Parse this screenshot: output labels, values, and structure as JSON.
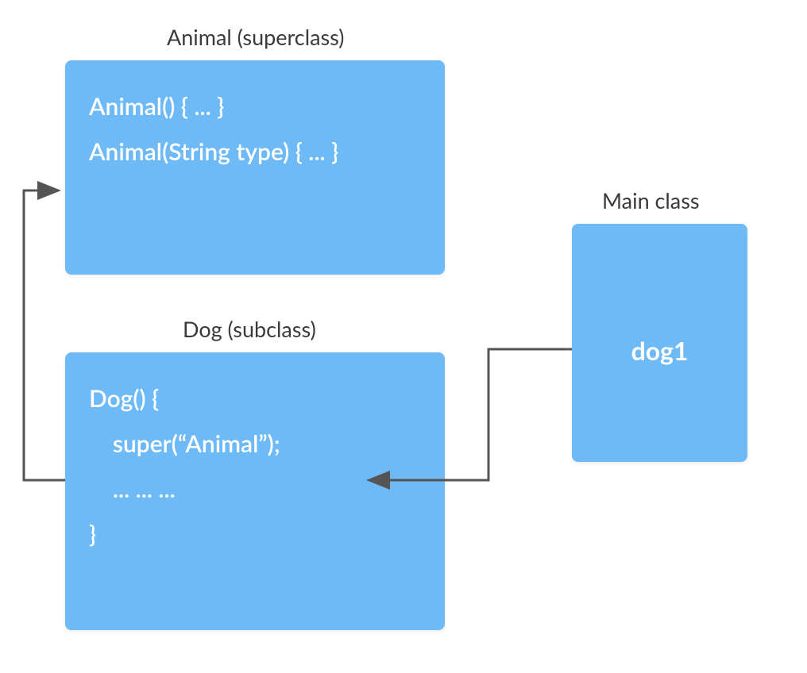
{
  "labels": {
    "animal": "Animal (superclass)",
    "dog": "Dog (subclass)",
    "main": "Main class"
  },
  "animalBox": {
    "line1": "Animal() { ... }",
    "line2": "Animal(String type) { ... }"
  },
  "dogBox": {
    "line1": "Dog() {",
    "line2": "    super(“Animal”);",
    "line3": "    ... ... ...",
    "line4": "}"
  },
  "mainBox": {
    "content": "dog1"
  },
  "colors": {
    "box_bg": "#6ebaf7",
    "arrow": "#555555",
    "label_text": "#3a3a3a",
    "box_text": "#ffffff"
  }
}
